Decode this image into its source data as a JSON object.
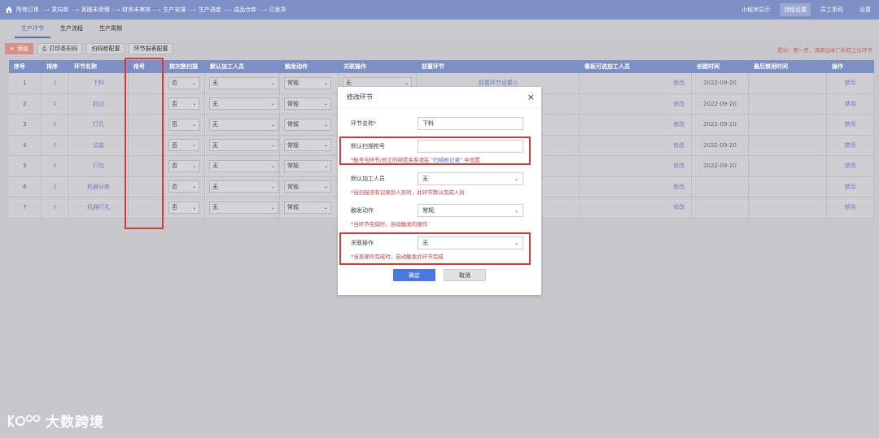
{
  "nav": {
    "flow": [
      "所有订单",
      "意向单",
      "客服未受理",
      "财务未审核",
      "生产安排",
      "生产进度",
      "成品仓库",
      "已发货"
    ],
    "right": [
      {
        "label": "小程序显示",
        "active": false
      },
      {
        "label": "流程设置",
        "active": true
      },
      {
        "label": "员工条码",
        "active": false
      },
      {
        "label": "设置",
        "active": false
      }
    ]
  },
  "subtabs": [
    "生产环节",
    "生产流程",
    "生产周期"
  ],
  "toolbar": {
    "add": "添加",
    "print": "打印条形码",
    "gun_config": "扫码枪配置",
    "report_config": "环节报表配置"
  },
  "hint": "提示：第一步，调添加本厂所有工位环节",
  "table": {
    "headers": [
      "序号",
      "排序",
      "环节名称",
      "枪号",
      "按次数扫描",
      "默认加工人员",
      "触发动作",
      "关联操作",
      "前置环节",
      "看板可选加工人员",
      "创建时间",
      "最后禁用时间",
      "操作"
    ],
    "rows": [
      {
        "no": "1",
        "name": "下料",
        "scan": "否",
        "worker": "无",
        "action": "常规",
        "rel": "无",
        "pre": "前置环节设置()",
        "edit": "修改",
        "created": "2022-09-20",
        "op": "禁用"
      },
      {
        "no": "2",
        "name": "封边",
        "scan": "否",
        "worker": "无",
        "action": "常规",
        "rel": "",
        "pre": "",
        "edit": "修改",
        "created": "2022-09-20",
        "op": "禁用"
      },
      {
        "no": "3",
        "name": "打孔",
        "scan": "否",
        "worker": "无",
        "action": "常规",
        "rel": "",
        "pre": "",
        "edit": "修改",
        "created": "2022-09-20",
        "op": "禁用"
      },
      {
        "no": "4",
        "name": "试装",
        "scan": "否",
        "worker": "无",
        "action": "常规",
        "rel": "",
        "pre": "",
        "edit": "修改",
        "created": "2022-09-20",
        "op": "禁用"
      },
      {
        "no": "5",
        "name": "打包",
        "scan": "否",
        "worker": "无",
        "action": "常规",
        "rel": "",
        "pre": "",
        "edit": "修改",
        "created": "2022-09-20",
        "op": "禁用"
      },
      {
        "no": "6",
        "name": "机器分拣",
        "scan": "否",
        "worker": "无",
        "action": "常规",
        "rel": "",
        "pre": "",
        "edit": "修改",
        "created": "",
        "op": "禁用"
      },
      {
        "no": "7",
        "name": "机器打孔",
        "scan": "否",
        "worker": "无",
        "action": "常规",
        "rel": "",
        "pre": "",
        "edit": "修改",
        "created": "",
        "op": "禁用"
      }
    ]
  },
  "modal": {
    "title": "修改环节",
    "name_label": "环节名称",
    "name_value": "下料",
    "gun_label": "默认扫描枪号",
    "gun_value": "",
    "gun_hint_a": "*枪号与环节/员工的绑定关系请在",
    "gun_hint_link": "\"扫描枪记录\"",
    "gun_hint_b": "中设置",
    "worker_label": "默认加工人员",
    "worker_value": "无",
    "worker_hint": "*当扫描没有记录到人员时，此环节默认完成人员",
    "action_label": "触发动作",
    "action_value": "常规",
    "action_hint": "*当环节完成时，自动触发的操作",
    "rel_label": "关联操作",
    "rel_value": "无",
    "rel_hint": "*当某操作完成时，自动触发此环节完成",
    "ok": "确定",
    "cancel": "取消"
  },
  "watermark": "大数跨境"
}
